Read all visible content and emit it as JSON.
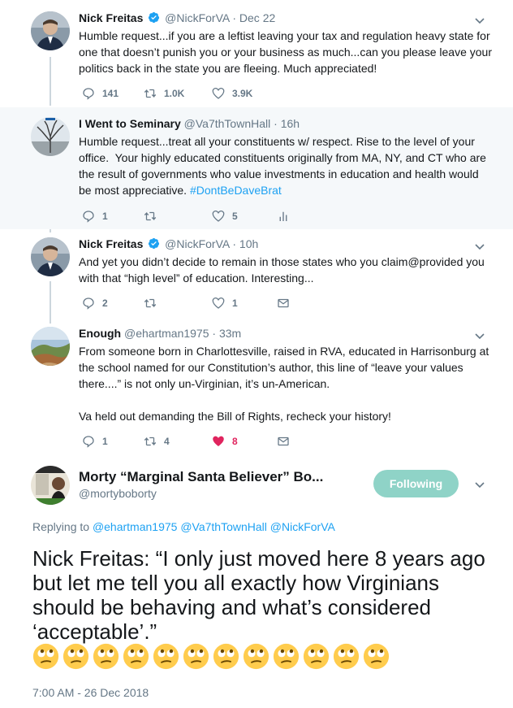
{
  "tweets": [
    {
      "name": "Nick Freitas",
      "verified": true,
      "handle": "@NickForVA",
      "time": "Dec 22",
      "text": "Humble request...if you are a leftist leaving your tax and regulation heavy state for one that doesn’t punish you or your business as much...can you please leave your politics back in the state you are fleeing. Much appreciated!",
      "replies": "141",
      "retweets": "1.0K",
      "likes": "3.9K"
    },
    {
      "name": "I Went to Seminary",
      "verified": false,
      "handle": "@Va7thTownHall",
      "time": "16h",
      "text": "Humble request...treat all your constituents w/ respect. Rise to the level of your office.  Your highly educated constituents originally from MA, NY, and CT who are the result of governments who value investments in education and health would be most appreciative. ",
      "hashtag": "#DontBeDaveBrat",
      "replies": "1",
      "retweets": "",
      "likes": "5"
    },
    {
      "name": "Nick Freitas",
      "verified": true,
      "handle": "@NickForVA",
      "time": "10h",
      "text": "And yet you didn’t decide to remain in those states who you claim@provided you with that “high level” of education. Interesting...",
      "replies": "2",
      "retweets": "",
      "likes": "1"
    },
    {
      "name": "Enough",
      "verified": false,
      "handle": "@ehartman1975",
      "time": "33m",
      "text": "From someone born in Charlottesville, raised in RVA, educated in Harrisonburg at the school named for our Constitution’s author, this line of “leave your values there....” is not only un-Virginian, it’s un-American.\n\nVa held out demanding the Bill of Rights, recheck your history!",
      "replies": "1",
      "retweets": "4",
      "likes": "8"
    }
  ],
  "main_tweet": {
    "name": "Morty “Marginal Santa Believer” Bo...",
    "handle": "@mortyboborty",
    "follow_label": "Following",
    "replying_prefix": "Replying to ",
    "replying_to": "@ehartman1975 @Va7thTownHall @NickForVA",
    "text": "Nick Freitas: “I only just moved here 8 years ago but let me tell you all exactly how Virginians should be behaving and what’s considered ‘acceptable’.”",
    "emoji": "rolling-eyes",
    "emoji_count": 12,
    "timestamp": "7:00 AM - 26 Dec 2018"
  },
  "colors": {
    "accent": "#1da1f2",
    "like": "#e0245e",
    "muted": "#657786",
    "follow_button": "#8fd3c7",
    "highlight_bg": "#f5f8fa"
  }
}
